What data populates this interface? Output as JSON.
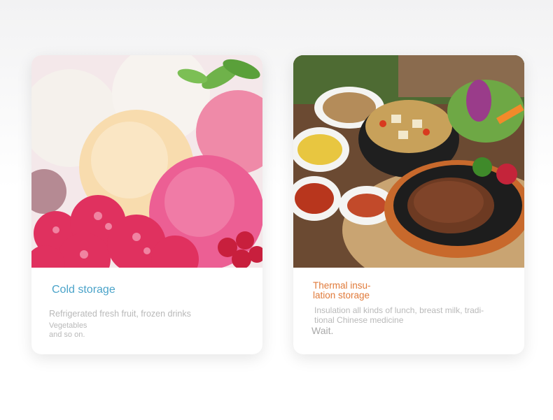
{
  "cards": [
    {
      "title": "Cold storage",
      "title_color": "#4aa3c9",
      "description": "Refrigerated fresh fruit, frozen drinks",
      "note_line1": "Vegetables",
      "note_line2": "and so on.",
      "image_subject": "ice-cream-and-frozen-raspberries"
    },
    {
      "title_line1": "Thermal insu-",
      "title_line2": "lation storage",
      "title_color": "#e07a3a",
      "description_line1": "Insulation all kinds of lunch, breast milk, tradi-",
      "description_line2": "tional Chinese medicine",
      "note": "Wait.",
      "image_subject": "korean-hotpot-and-steak-meal"
    }
  ]
}
